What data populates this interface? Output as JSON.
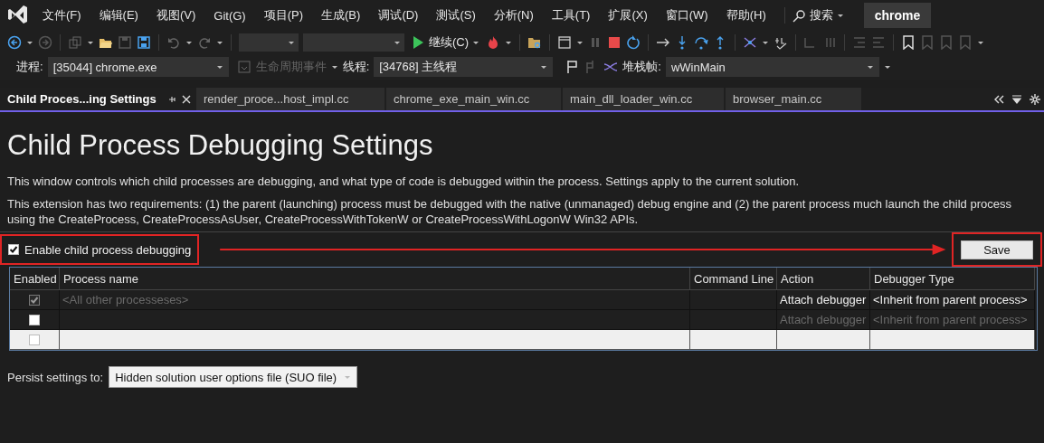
{
  "window": {
    "title": "chrome"
  },
  "menu": [
    "文件(F)",
    "编辑(E)",
    "视图(V)",
    "Git(G)",
    "项目(P)",
    "生成(B)",
    "调试(D)",
    "测试(S)",
    "分析(N)",
    "工具(T)",
    "扩展(X)",
    "窗口(W)",
    "帮助(H)"
  ],
  "search": {
    "label": "搜索"
  },
  "toolbar": {
    "continue": "继续(C)"
  },
  "debug_bar": {
    "process_label": "进程:",
    "process": "[35044] chrome.exe",
    "lifecycle": "生命周期事件",
    "thread_label": "线程:",
    "thread": "[34768] 主线程",
    "stack_label": "堆栈帧:",
    "stack_frame": "wWinMain"
  },
  "tabs": [
    {
      "label": "Child Proces...ing Settings",
      "selected": true
    },
    {
      "label": "render_proce...host_impl.cc",
      "selected": false
    },
    {
      "label": "chrome_exe_main_win.cc",
      "selected": false
    },
    {
      "label": "main_dll_loader_win.cc",
      "selected": false
    },
    {
      "label": "browser_main.cc",
      "selected": false
    }
  ],
  "page": {
    "title": "Child Process Debugging Settings",
    "description": "This window controls which child processes are debugging, and what type of code is debugged within the process. Settings apply to the current solution.",
    "requirements": "This extension has two requirements: (1) the parent (launching) process must be debugged with the native (unmanaged) debug engine and (2) the parent process much launch the child process using the CreateProcess, CreateProcessAsUser, CreateProcessWithTokenW or CreateProcessWithLogonW Win32 APIs.",
    "enable": {
      "label": "Enable child process debugging",
      "checked": true
    },
    "save": "Save"
  },
  "table": {
    "columns": [
      "Enabled",
      "Process name",
      "Command Line",
      "Action",
      "Debugger Type"
    ],
    "rows": [
      {
        "kind": "default",
        "checked": true,
        "disabled": true,
        "dimmed": false,
        "process_name": "<All other processeses>",
        "action": "Attach debugger",
        "debugger_type": "<Inherit from parent process>"
      },
      {
        "kind": "entry",
        "checked": false,
        "disabled": false,
        "dimmed": true,
        "action": "Attach debugger",
        "debugger_type": "<Inherit from parent process>"
      },
      {
        "kind": "new",
        "checked": false,
        "disabled": false
      }
    ]
  },
  "persist": {
    "label": "Persist settings to:",
    "value": "Hidden solution user options file (SUO file)"
  }
}
